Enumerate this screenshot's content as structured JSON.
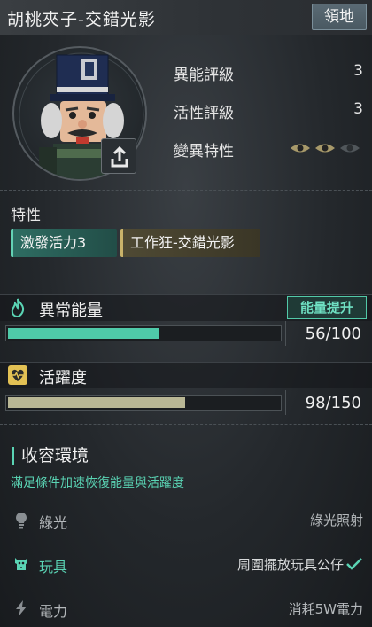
{
  "header": {
    "title": "胡桃夾子-交錯光影",
    "badge": "領地"
  },
  "portrait": {
    "alt": "nutcracker-portrait"
  },
  "stats": [
    {
      "label": "異能評級",
      "value": "3"
    },
    {
      "label": "活性評級",
      "value": "3"
    },
    {
      "label": "變異特性"
    }
  ],
  "mutation_eyes": {
    "active": 2,
    "total": 3
  },
  "traits": {
    "title": "特性",
    "tags": [
      "激發活力3",
      "工作狂-交錯光影"
    ]
  },
  "energy": {
    "label": "異常能量",
    "button": "能量提升",
    "value_text": "56/100",
    "current": 56,
    "max": 100,
    "color": "#4fcaa9"
  },
  "activity": {
    "label": "活躍度",
    "value_text": "98/150",
    "current": 98,
    "max": 150,
    "color": "#b9b795"
  },
  "containment": {
    "title": "收容環境",
    "subtitle": "滿足條件加速恢復能量與活躍度",
    "rows": [
      {
        "name": "綠光",
        "desc": "綠光照射",
        "icon": "lightbulb-icon",
        "met": false
      },
      {
        "name": "玩具",
        "desc": "周圍擺放玩具公仔",
        "icon": "toy-icon",
        "met": true
      },
      {
        "name": "電力",
        "desc": "消耗5W電力",
        "icon": "lightning-icon",
        "met": false
      }
    ]
  },
  "colors": {
    "accent": "#5ad4b4",
    "gold": "#c9b36a",
    "muted": "#9a9fa3"
  }
}
